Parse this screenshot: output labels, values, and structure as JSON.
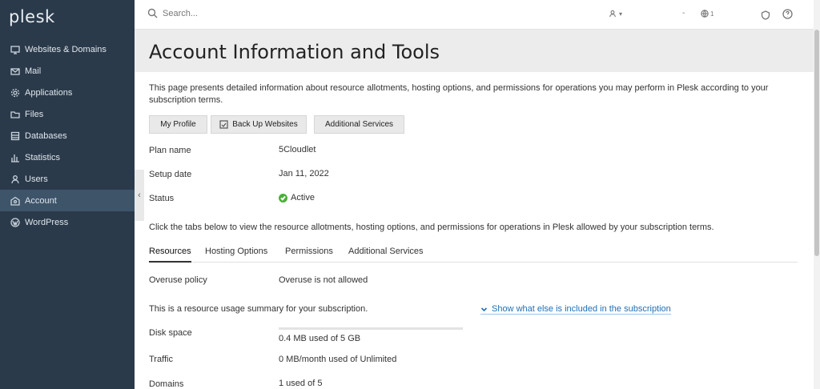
{
  "sidebar": {
    "logo": "plesk",
    "items": [
      {
        "label": "Websites & Domains",
        "icon": "monitor-icon"
      },
      {
        "label": "Mail",
        "icon": "mail-icon"
      },
      {
        "label": "Applications",
        "icon": "gear-icon"
      },
      {
        "label": "Files",
        "icon": "folder-icon"
      },
      {
        "label": "Databases",
        "icon": "database-icon"
      },
      {
        "label": "Statistics",
        "icon": "bar-chart-icon"
      },
      {
        "label": "Users",
        "icon": "user-icon"
      },
      {
        "label": "Account",
        "icon": "account-icon"
      },
      {
        "label": "WordPress",
        "icon": "wordpress-icon"
      }
    ],
    "active_item": "Account",
    "collapse_glyph": "‹"
  },
  "header": {
    "search_placeholder": "Search...",
    "user_caret": "▾",
    "dash": "-",
    "globe_sup": "1"
  },
  "page": {
    "title": "Account Information and Tools",
    "intro": "This page presents detailed information about resource allotments, hosting options, and permissions for operations you may perform in Plesk according to your subscription terms."
  },
  "buttons": {
    "my_profile": "My Profile",
    "backup": "Back Up Websites",
    "additional": "Additional Services"
  },
  "info": {
    "plan_label": "Plan name",
    "plan_value": "5Cloudlet",
    "setup_label": "Setup date",
    "setup_value": "Jan 11, 2022",
    "status_label": "Status",
    "status_value": "Active"
  },
  "tabs_description": "Click the tabs below to view the resource allotments, hosting options, and permissions for operations in Plesk allowed by your subscription terms.",
  "tabs": [
    {
      "label": "Resources",
      "active": true
    },
    {
      "label": "Hosting Options",
      "active": false
    },
    {
      "label": "Permissions",
      "active": false
    },
    {
      "label": "Additional Services",
      "active": false
    }
  ],
  "resources": {
    "overuse_label": "Overuse policy",
    "overuse_value": "Overuse is not allowed",
    "summary": "This is a resource usage summary for your subscription.",
    "show_more": "Show what else is included in the subscription",
    "disk_label": "Disk space",
    "disk_value": "0.4 MB used of 5 GB",
    "disk_fraction": 0.0001,
    "traffic_label": "Traffic",
    "traffic_value": "0 MB/month used of Unlimited",
    "domains_label": "Domains",
    "domains_value": "1 used of 5"
  },
  "colors": {
    "sidebar_bg": "#2b3a4a",
    "active_bg": "#3e5469",
    "link": "#1f6fb5",
    "status_ok": "#4caf3a"
  }
}
